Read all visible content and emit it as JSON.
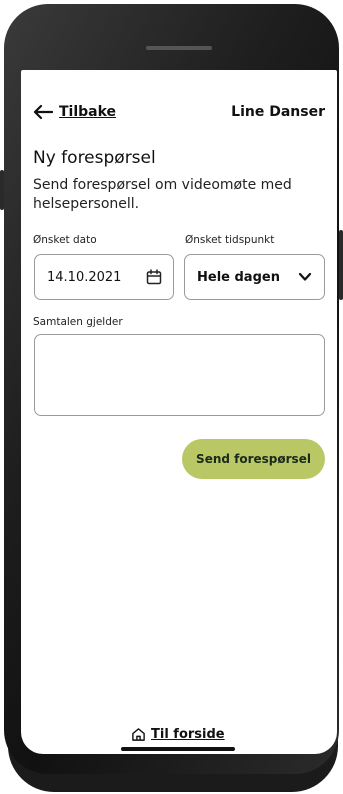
{
  "header": {
    "back_label": "Tilbake",
    "user_name": "Line Danser"
  },
  "form": {
    "title": "Ny forespørsel",
    "description": "Send forespørsel om videomøte med helsepersonell.",
    "date_label": "Ønsket dato",
    "date_value": "14.10.2021",
    "time_label": "Ønsket tidspunkt",
    "time_value": "Hele dagen",
    "topic_label": "Samtalen gjelder",
    "topic_value": "",
    "send_label": "Send forespørsel"
  },
  "footer": {
    "home_label": "Til forside"
  },
  "icons": {
    "back": "arrow-left-icon",
    "calendar": "calendar-icon",
    "chevron": "chevron-down-icon",
    "home": "home-icon"
  },
  "colors": {
    "accent": "#b9c865",
    "frame": "#1b1b1b"
  }
}
